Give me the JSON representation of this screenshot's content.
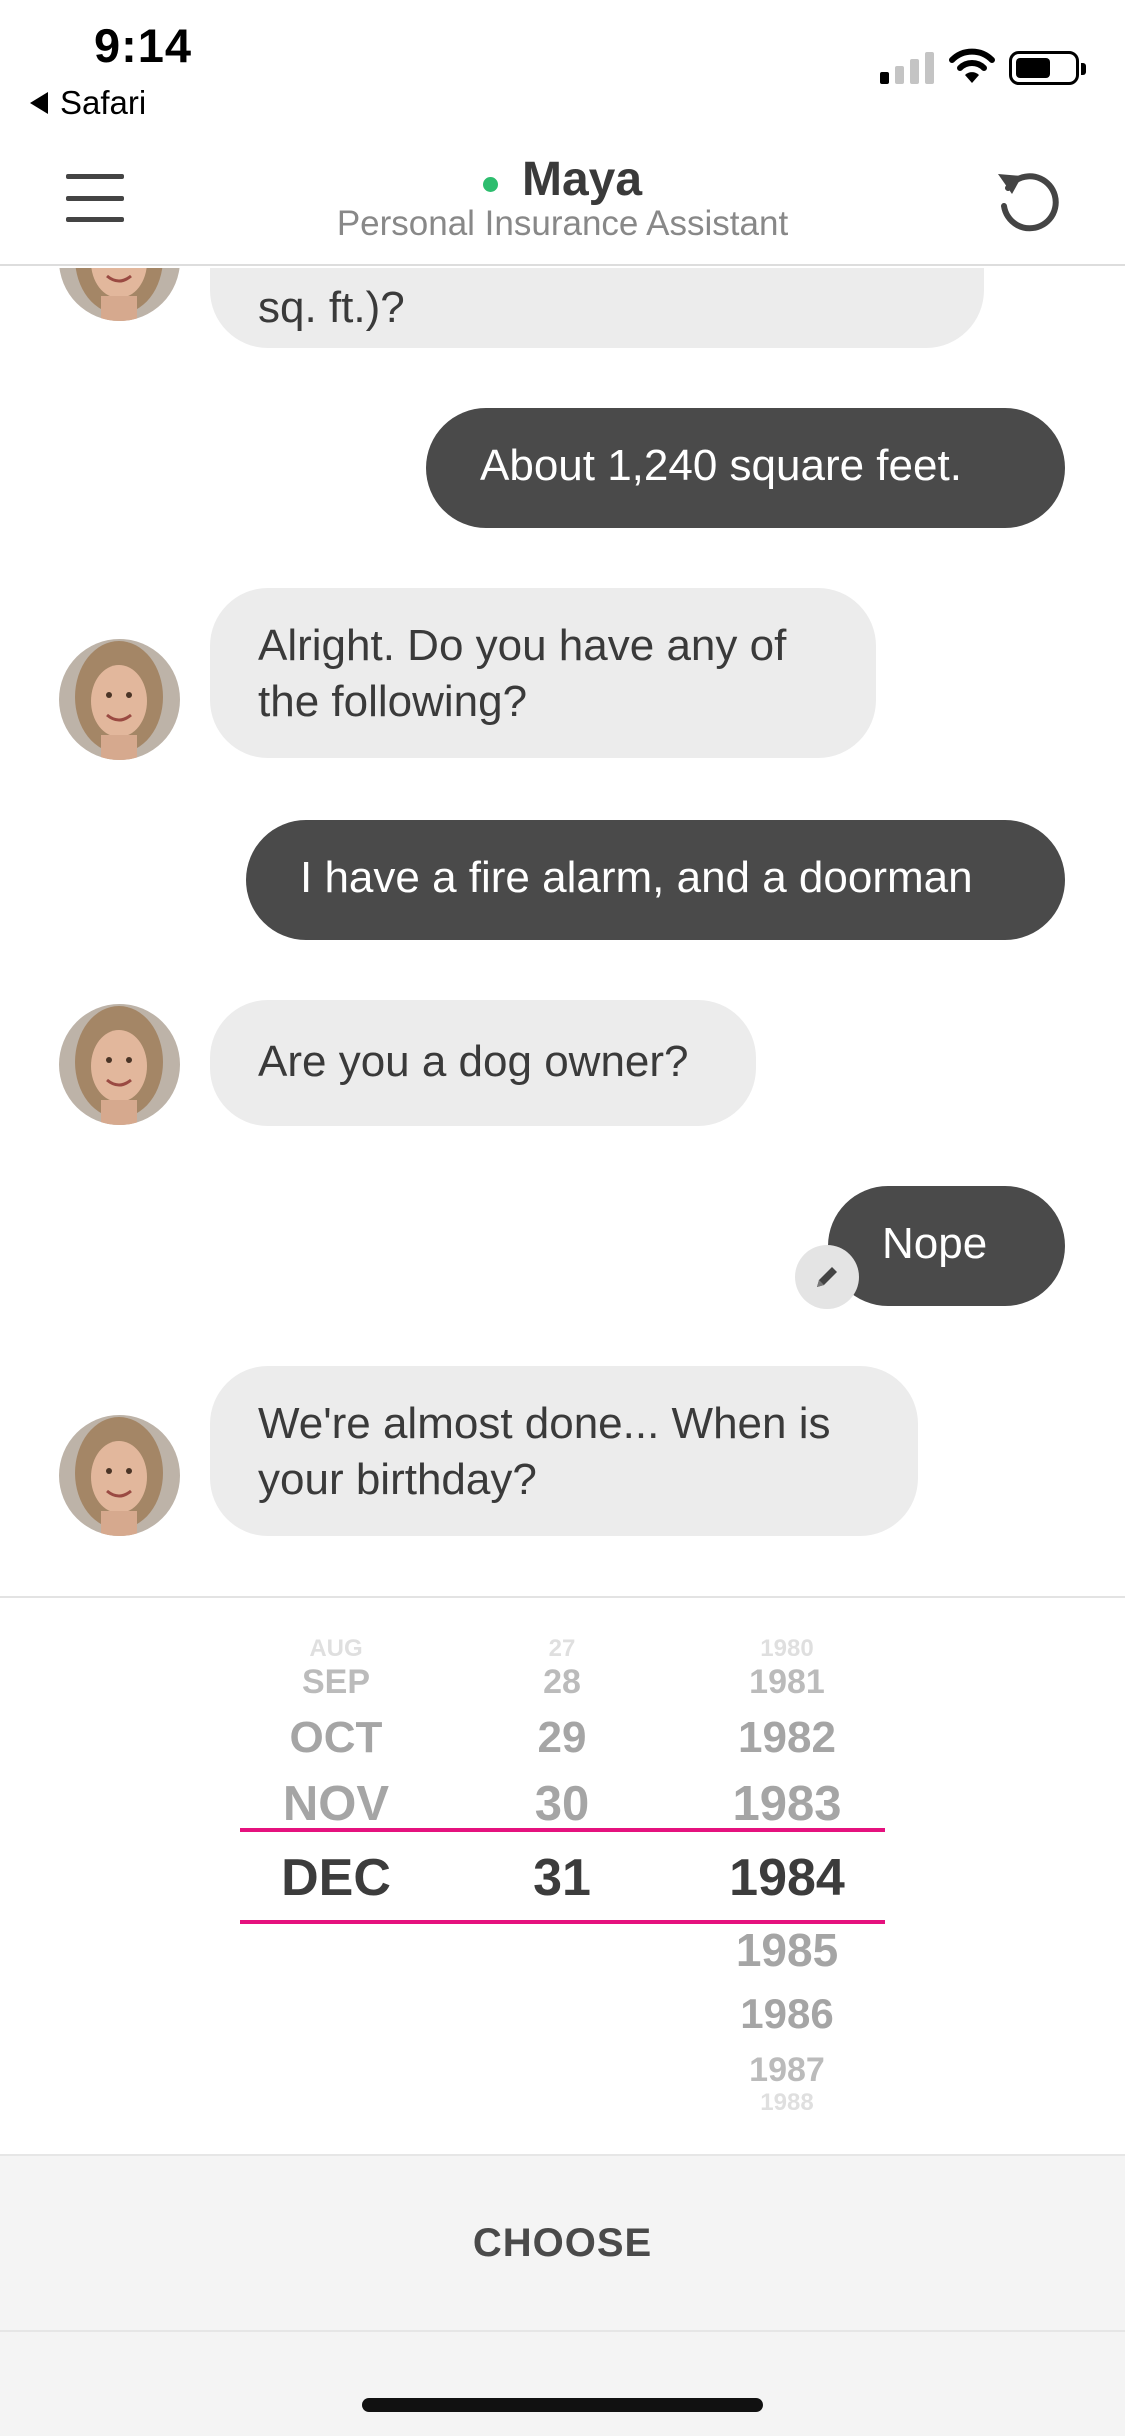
{
  "status_bar": {
    "time": "9:14",
    "back_label": "Safari",
    "icons": [
      "signal-icon",
      "wifi-icon",
      "battery-icon"
    ]
  },
  "header": {
    "agent_name": "Maya",
    "agent_subtitle": "Personal Insurance Assistant",
    "online_color": "#2dbd6e",
    "menu_icon": "hamburger-icon",
    "restart_icon": "restart-icon"
  },
  "messages": [
    {
      "from": "bot",
      "text": "sq. ft.)?"
    },
    {
      "from": "user",
      "text": "About 1,240 square feet."
    },
    {
      "from": "bot",
      "text": "Alright. Do you have any of the following?"
    },
    {
      "from": "user",
      "text": "I have a fire alarm, and a doorman"
    },
    {
      "from": "bot",
      "text": "Are you a dog owner?"
    },
    {
      "from": "user",
      "text": "Nope",
      "editable": true
    },
    {
      "from": "bot",
      "text": "We're almost done... When is your birthday?"
    }
  ],
  "date_picker": {
    "accent_color": "#e5117e",
    "months": [
      "AUG",
      "SEP",
      "OCT",
      "NOV",
      "DEC"
    ],
    "days": [
      "27",
      "28",
      "29",
      "30",
      "31"
    ],
    "years": [
      "1980",
      "1981",
      "1982",
      "1983",
      "1984",
      "1985",
      "1986",
      "1987",
      "1988"
    ],
    "selected": {
      "month": "DEC",
      "day": "31",
      "year": "1984"
    }
  },
  "choose_button": {
    "label": "CHOOSE"
  }
}
